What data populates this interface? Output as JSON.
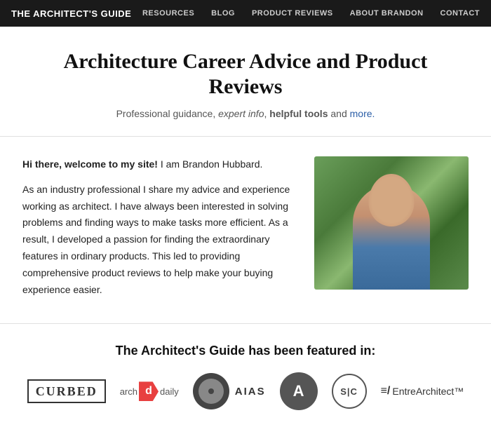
{
  "nav": {
    "logo": "THE ARCHITECT'S GUIDE",
    "links": [
      {
        "label": "RESOURCES",
        "id": "resources"
      },
      {
        "label": "BLOG",
        "id": "blog"
      },
      {
        "label": "PRODUCT REVIEWS",
        "id": "product-reviews"
      },
      {
        "label": "ABOUT BRANDON",
        "id": "about-brandon"
      },
      {
        "label": "CONTACT",
        "id": "contact"
      }
    ]
  },
  "hero": {
    "title": "Architecture Career Advice and Product Reviews",
    "subtitle": "Professional guidance, expert info, helpful tools and more."
  },
  "intro": {
    "greeting": "Hi there, welcome to my site! I am Brandon Hubbard.",
    "body1": "As an industry professional I share my advice and experience working as architect. I have always been interested in solving problems and finding ways to make tasks more efficient. As a result, I developed a passion for finding the extraordinary features in ordinary products. This led to providing comprehensive product reviews to help make your buying experience easier."
  },
  "featured": {
    "title": "The Architect's Guide has been featured in:",
    "logos": [
      {
        "name": "CURBED",
        "type": "curbed"
      },
      {
        "name": "arch daily",
        "type": "archdaily"
      },
      {
        "name": "AIAS",
        "type": "aias"
      },
      {
        "name": "AIA",
        "type": "aia"
      },
      {
        "name": "S|C",
        "type": "sc"
      },
      {
        "name": "EntreArchitect",
        "type": "entre"
      }
    ]
  }
}
